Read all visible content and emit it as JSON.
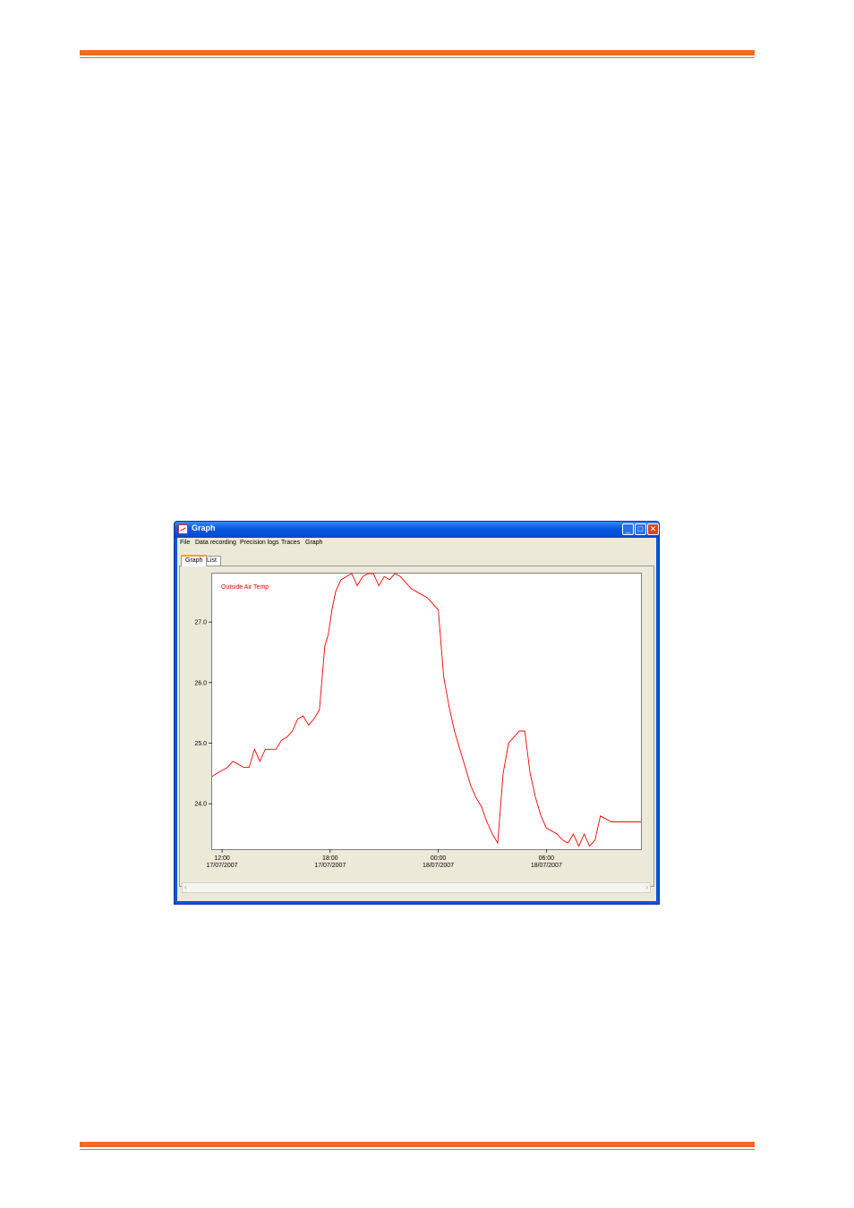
{
  "window": {
    "title": "Graph",
    "buttons": {
      "minimize": "_",
      "maximize": "□",
      "close": "✕"
    }
  },
  "menu": [
    "File",
    "Data recording",
    "Precision logs",
    "Traces",
    "Graph"
  ],
  "tabs": [
    {
      "label": "Graph",
      "active": true
    },
    {
      "label": "List",
      "active": false
    }
  ],
  "chart_data": {
    "type": "line",
    "title": "",
    "xlabel": "",
    "ylabel": "",
    "ylim": [
      23.25,
      27.8
    ],
    "yticks": [
      24.0,
      25.0,
      26.0,
      27.0
    ],
    "ytick_labels": [
      "24.0",
      "25.0",
      "26.0",
      "27.0"
    ],
    "xlim": [
      11.45,
      35.25
    ],
    "xticks": [
      {
        "value": 12,
        "time": "12:00",
        "date": "17/07/2007"
      },
      {
        "value": 18,
        "time": "18:00",
        "date": "17/07/2007"
      },
      {
        "value": 24,
        "time": "00:00",
        "date": "18/07/2007"
      },
      {
        "value": 30,
        "time": "06:00",
        "date": "18/07/2007"
      }
    ],
    "grid": false,
    "series": [
      {
        "name": "Outside Air Temp",
        "color": "#ff0000",
        "x": [
          11.45,
          11.7,
          12.0,
          12.3,
          12.6,
          12.9,
          13.2,
          13.5,
          13.8,
          14.1,
          14.4,
          14.7,
          15.0,
          15.3,
          15.6,
          15.9,
          16.2,
          16.5,
          16.8,
          17.1,
          17.4,
          17.7,
          17.9,
          18.1,
          18.3,
          18.6,
          18.9,
          19.2,
          19.5,
          19.8,
          20.1,
          20.4,
          20.7,
          21.0,
          21.3,
          21.6,
          21.9,
          22.2,
          22.5,
          22.8,
          23.1,
          23.4,
          23.7,
          24.0,
          24.3,
          24.6,
          24.9,
          25.2,
          25.5,
          25.8,
          26.1,
          26.4,
          26.7,
          27.0,
          27.3,
          27.6,
          27.9,
          28.2,
          28.5,
          28.8,
          29.1,
          29.4,
          29.7,
          30.0,
          30.3,
          30.6,
          30.9,
          31.2,
          31.5,
          31.8,
          32.1,
          32.4,
          32.7,
          33.0,
          33.3,
          33.6,
          33.9,
          34.2,
          34.5,
          34.8,
          35.0,
          35.25
        ],
        "y": [
          24.45,
          24.5,
          24.55,
          24.6,
          24.7,
          24.65,
          24.6,
          24.6,
          24.9,
          24.7,
          24.9,
          24.9,
          24.9,
          25.05,
          25.1,
          25.2,
          25.4,
          25.45,
          25.3,
          25.4,
          25.55,
          26.6,
          26.8,
          27.2,
          27.5,
          27.7,
          27.75,
          27.8,
          27.6,
          27.75,
          27.8,
          27.8,
          27.6,
          27.75,
          27.7,
          27.8,
          27.75,
          27.65,
          27.55,
          27.5,
          27.45,
          27.4,
          27.3,
          27.2,
          26.1,
          25.6,
          25.2,
          24.9,
          24.6,
          24.3,
          24.1,
          23.95,
          23.7,
          23.5,
          23.35,
          24.5,
          25.0,
          25.1,
          25.2,
          25.2,
          24.5,
          24.1,
          23.8,
          23.6,
          23.55,
          23.5,
          23.4,
          23.35,
          23.5,
          23.3,
          23.5,
          23.3,
          23.4,
          23.8,
          23.75,
          23.7,
          23.7,
          23.7,
          23.7,
          23.7,
          23.7,
          23.7
        ]
      }
    ]
  }
}
